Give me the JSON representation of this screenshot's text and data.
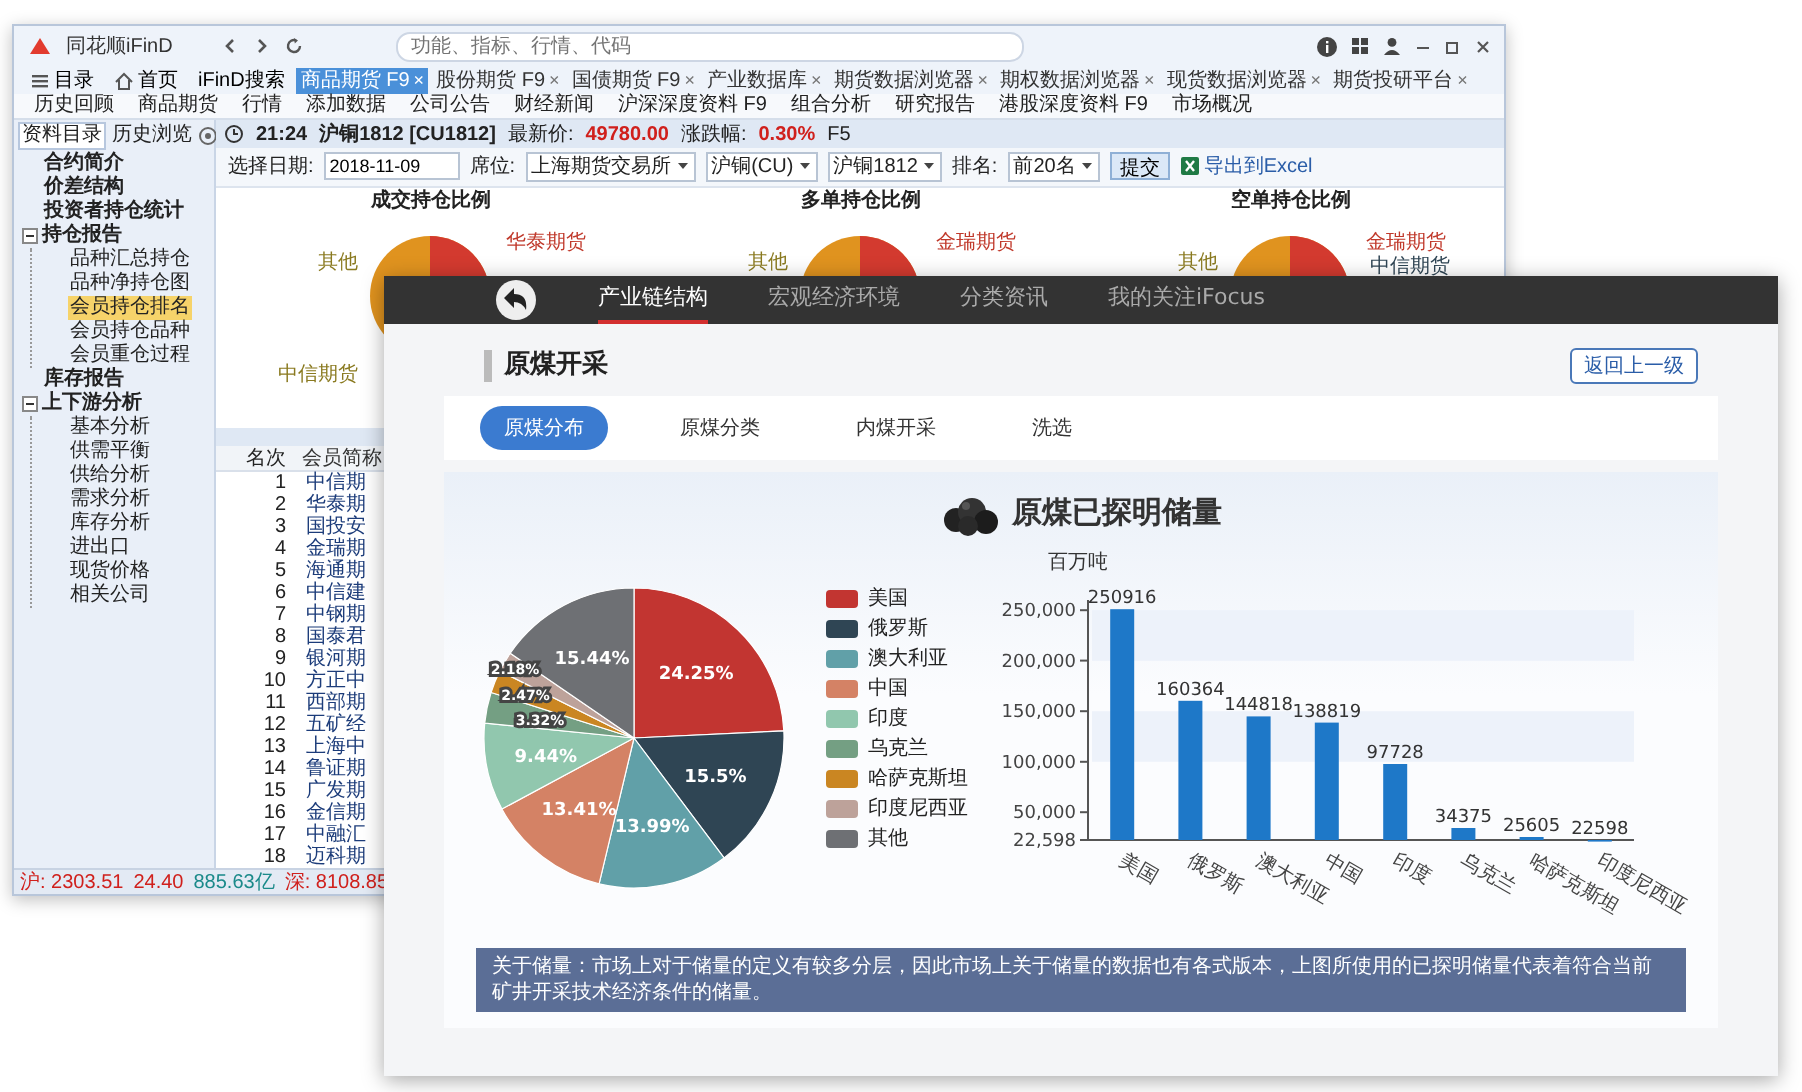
{
  "back_window": {
    "logo": "同花顺iFinD",
    "search": {
      "placeholder": "功能、指标、行情、代码"
    },
    "toolbar": [
      {
        "label": "目录",
        "kind": "list"
      },
      {
        "label": "首页",
        "kind": "home"
      },
      {
        "label": "iFinD搜索",
        "kind": "plain"
      }
    ],
    "tabs": [
      {
        "label": "商品期货 F9",
        "close": "×",
        "selected": true
      },
      {
        "label": "股份期货 F9",
        "close": "×",
        "selected": false
      },
      {
        "label": "国债期货 F9",
        "close": "×",
        "selected": false
      },
      {
        "label": "产业数据库",
        "close": "×",
        "selected": false
      },
      {
        "label": "期货数据浏览器",
        "close": "×",
        "selected": false
      },
      {
        "label": "期权数据浏览器",
        "close": "×",
        "selected": false
      },
      {
        "label": "现货数据浏览器",
        "close": "×",
        "selected": false
      },
      {
        "label": "期货投研平台",
        "close": "×",
        "selected": false
      }
    ],
    "menu": [
      "历史回顾",
      "商品期货",
      "行情",
      "添加数据",
      "公司公告",
      "财经新闻",
      "沪深深度资料 F9",
      "组合分析",
      "研究报告",
      "港股深度资料 F9",
      "市场概况"
    ],
    "sidebar": {
      "tabs": [
        {
          "label": "资料目录",
          "selected": true
        },
        {
          "label": "历史浏览",
          "selected": false
        }
      ],
      "tree": [
        {
          "label": "合约简介",
          "selected": false
        },
        {
          "label": "价差结构",
          "selected": false
        },
        {
          "label": "投资者持仓统计",
          "selected": false
        },
        {
          "label": "持仓报告",
          "selected": false,
          "expanded": true,
          "children": [
            {
              "label": "品种汇总持仓",
              "selected": false
            },
            {
              "label": "品种净持仓图",
              "selected": false
            },
            {
              "label": "会员持仓排名",
              "selected": true
            },
            {
              "label": "会员持仓品种",
              "selected": false
            },
            {
              "label": "会员重仓过程",
              "selected": false
            }
          ]
        },
        {
          "label": "库存报告",
          "selected": false
        },
        {
          "label": "上下游分析",
          "selected": false,
          "expanded": true,
          "children": [
            {
              "label": "基本分析",
              "selected": false
            },
            {
              "label": "供需平衡",
              "selected": false
            },
            {
              "label": "供给分析",
              "selected": false
            },
            {
              "label": "需求分析",
              "selected": false
            },
            {
              "label": "库存分析",
              "selected": false
            },
            {
              "label": "进出口",
              "selected": false
            },
            {
              "label": "现货价格",
              "selected": false
            },
            {
              "label": "相关公司",
              "selected": false
            }
          ]
        }
      ]
    },
    "quote": {
      "time": "21:24",
      "instrument": "沪铜1812 [CU1812]",
      "price_label": "最新价:",
      "price": "49780.00",
      "change_label": "涨跌幅:",
      "change": "0.30%",
      "hotkey": "F5"
    },
    "filters": {
      "date_label": "选择日期:",
      "date": "2018-11-09",
      "seat_label": "席位:",
      "selects": [
        "上海期货交易所",
        "沪铜(CU)",
        "沪铜1812"
      ],
      "rank_label": "排名:",
      "rank": "前20名",
      "submit": "提交",
      "export": "导出到Excel"
    },
    "pies": [
      {
        "title": "成交持仓比例",
        "labels": [
          {
            "text": "华泰期货",
            "kind": "right"
          },
          {
            "text": "其他",
            "kind": "left"
          },
          {
            "text": "中信期货",
            "kind": "below"
          }
        ]
      },
      {
        "title": "多单持仓比例",
        "labels": [
          {
            "text": "金瑞期货",
            "kind": "right"
          },
          {
            "text": "其他",
            "kind": "left"
          }
        ]
      },
      {
        "title": "空单持仓比例",
        "labels": [
          {
            "text": "金瑞期货",
            "kind": "right"
          },
          {
            "text": "中信期货",
            "kind": "side"
          },
          {
            "text": "其他",
            "kind": "left"
          }
        ]
      }
    ],
    "table": {
      "columns": [
        "名次",
        "会员简称"
      ],
      "rows": [
        [
          "1",
          "中信期"
        ],
        [
          "2",
          "华泰期"
        ],
        [
          "3",
          "国投安"
        ],
        [
          "4",
          "金瑞期"
        ],
        [
          "5",
          "海通期"
        ],
        [
          "6",
          "中信建"
        ],
        [
          "7",
          "中钢期"
        ],
        [
          "8",
          "国泰君"
        ],
        [
          "9",
          "银河期"
        ],
        [
          "10",
          "方正中"
        ],
        [
          "11",
          "西部期"
        ],
        [
          "12",
          "五矿经"
        ],
        [
          "13",
          "上海中"
        ],
        [
          "14",
          "鲁证期"
        ],
        [
          "15",
          "广发期"
        ],
        [
          "16",
          "金信期"
        ],
        [
          "17",
          "中融汇"
        ],
        [
          "18",
          "迈科期"
        ]
      ]
    },
    "status_bar": [
      {
        "text": "沪: 2303.51",
        "kind": "index"
      },
      {
        "text": "24.40",
        "kind": "change"
      },
      {
        "text": "885.63亿",
        "kind": "amount"
      },
      {
        "text": "深: 8108.85",
        "kind": "index"
      }
    ]
  },
  "front_window": {
    "nav": [
      {
        "label": "产业链结构",
        "selected": true
      },
      {
        "label": "宏观经济环境",
        "selected": false
      },
      {
        "label": "分类资讯",
        "selected": false
      },
      {
        "label": "我的关注iFocus",
        "selected": false
      }
    ],
    "section_title": "原煤开采",
    "back_button": "返回上一级",
    "subtabs": [
      {
        "label": "原煤分布",
        "selected": true
      },
      {
        "label": "原煤分类",
        "selected": false
      },
      {
        "label": "内煤开采",
        "selected": false
      },
      {
        "label": "洗选",
        "selected": false
      }
    ],
    "panel": {
      "title": "原煤已探明储量",
      "pie": {
        "chart_data": {
          "type": "pie",
          "categories": [
            "美国",
            "俄罗斯",
            "澳大利亚",
            "中国",
            "印度",
            "乌克兰",
            "哈萨克斯坦",
            "印度尼西亚",
            "其他"
          ],
          "values": [
            24.25,
            15.5,
            13.99,
            13.41,
            9.44,
            3.32,
            2.47,
            2.18,
            15.44
          ],
          "value_labels": [
            "24.25%",
            "15.5%",
            "13.99%",
            "13.41%",
            "9.44%",
            "3.32%",
            "2.47%",
            "2.18%",
            "15.44%"
          ],
          "colors": [
            "#c23531",
            "#2f4554",
            "#61a0a8",
            "#d48265",
            "#91c7ae",
            "#749f83",
            "#ca8622",
            "#bda29a",
            "#6e7074"
          ]
        }
      },
      "bar": {
        "chart_data": {
          "type": "bar",
          "ylabel": "百万吨",
          "categories": [
            "美国",
            "俄罗斯",
            "澳大利亚",
            "中国",
            "印度",
            "乌克兰",
            "哈萨克斯坦",
            "印度尼西亚"
          ],
          "values": [
            250916,
            160364,
            144818,
            138819,
            97728,
            34375,
            25605,
            22598
          ],
          "value_labels": [
            "250916",
            "160364",
            "144818",
            "138819",
            "97728",
            "34375",
            "25605",
            "22598"
          ],
          "ylim": [
            22598,
            260000
          ],
          "yticks": [
            {
              "value": 22598,
              "label": "22,598"
            },
            {
              "value": 50000,
              "label": "50,000"
            },
            {
              "value": 100000,
              "label": "100,000"
            },
            {
              "value": 150000,
              "label": "150,000"
            },
            {
              "value": 200000,
              "label": "200,000"
            },
            {
              "value": 250000,
              "label": "250,000"
            }
          ]
        }
      }
    },
    "note": "关于储量：市场上对于储量的定义有较多分层，因此市场上关于储量的数据也有各式版本，上图所使用的已探明储量代表着符合当前矿井开采技术经济条件的储量。"
  }
}
